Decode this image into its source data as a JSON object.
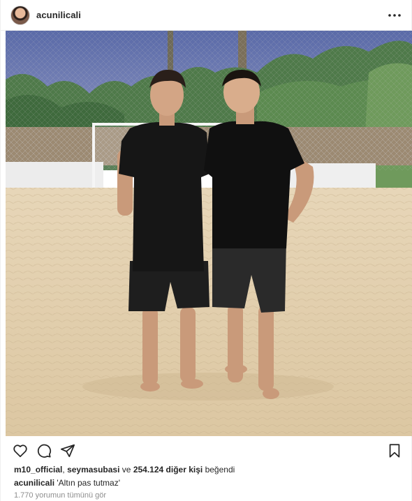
{
  "header": {
    "username": "acunilicali",
    "avatar_icon": "profile-avatar",
    "more_icon": "more-dots-icon"
  },
  "photo": {
    "description_icon": "post-photo"
  },
  "actions": {
    "like_icon": "heart-icon",
    "comment_icon": "comment-icon",
    "share_icon": "share-icon",
    "save_icon": "bookmark-icon"
  },
  "likes": {
    "user1": "m10_official",
    "separator": ",",
    "user2": "seymasubasi",
    "middle": "ve",
    "count": "254.124 diğer kişi",
    "suffix": "beğendi"
  },
  "caption": {
    "username": "acunilicali",
    "text": "'Altın pas tutmaz'"
  },
  "comments": {
    "view_all": "1.770 yorumun tümünü gör"
  },
  "colors": {
    "text": "#262626",
    "muted": "#8e8e8e",
    "border": "#efefef"
  }
}
